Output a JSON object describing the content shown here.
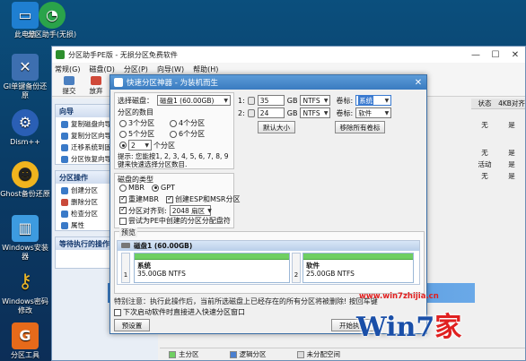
{
  "desktop": {
    "icons": [
      {
        "label": "此电脑",
        "color": "#1f7fd1"
      },
      {
        "label": "分区助手(无损)",
        "color": "#2aa34a"
      },
      {
        "label": "GI单键备份还原",
        "color": "#3d6fb0"
      },
      {
        "label": "Dism++",
        "color": "#2a5fb5"
      },
      {
        "label": "Ghost备份还原",
        "color": "#f0b41e"
      },
      {
        "label": "Windows安装器",
        "color": "#3d9be0"
      },
      {
        "label": "Windows密码修改",
        "color": "#e8b52a"
      },
      {
        "label": "分区工具",
        "color": "#e66a1a"
      }
    ]
  },
  "app": {
    "title": "分区助手PE版 - 无损分区免费软件",
    "window_buttons": [
      "—",
      "☐",
      "✕"
    ],
    "menus": [
      "常规(G)",
      "磁盘(D)",
      "分区(P)",
      "向导(W)",
      "帮助(H)"
    ],
    "toolbar": [
      {
        "label": "提交"
      },
      {
        "label": "放弃"
      }
    ],
    "left_sections": [
      {
        "title": "向导",
        "items": [
          "复制磁盘向导",
          "复制分区向导",
          "迁移系统到固态",
          "分区恢复向导"
        ]
      },
      {
        "title": "分区操作",
        "items": [
          "创建分区",
          "删除分区",
          "检查分区",
          "属性"
        ]
      },
      {
        "title": "等待执行的操作",
        "items": []
      }
    ],
    "columns": [
      "状态",
      "4KB对齐"
    ],
    "rows": [
      [
        "无",
        "是"
      ],
      [
        "无",
        "是"
      ],
      [
        "活动",
        "是"
      ],
      [
        "无",
        "是"
      ]
    ],
    "legend": [
      {
        "label": "主分区",
        "color": "#6fcf62"
      },
      {
        "label": "逻辑分区",
        "color": "#4a7fd0"
      },
      {
        "label": "未分配空间",
        "color": "#dcdcdc"
      }
    ]
  },
  "dialog": {
    "title": "快速分区神器 - 为装机而生",
    "close": "✕",
    "select_disk_label": "选择磁盘：",
    "select_disk_value": "磁盘1 (60.00GB)",
    "partition_count_label": "分区的数目",
    "count_options": [
      "3个分区",
      "4个分区",
      "5个分区",
      "6个分区"
    ],
    "custom_count_value": "2",
    "custom_count_suffix": "个分区",
    "hint": "提示: 您能按1, 2, 3, 4, 5, 6, 7, 8, 9键来快速选择分区数目.",
    "disk_type_label": "磁盘的类型",
    "disk_types": [
      "MBR",
      "GPT"
    ],
    "rebuild_mbr": "重建MBR",
    "create_esp": "创建ESP和MSR分区",
    "align_label": "分区对齐到:",
    "align_value": "2048 扇区",
    "pe_hint": "尝试为PE中创建的分区分配盘符",
    "partitions": [
      {
        "index": "1:",
        "size": "35",
        "unit": "GB",
        "fs": "NTFS",
        "label_text": "卷标:",
        "label_value": "系统"
      },
      {
        "index": "2:",
        "size": "24",
        "unit": "GB",
        "fs": "NTFS",
        "label_text": "卷标:",
        "label_value": "软件"
      }
    ],
    "default_size_btn": "默认大小",
    "remove_labels_btn": "移除所有卷标",
    "preview_label": "预览",
    "disk_name": "磁盘1 (60.00GB)",
    "parts_preview": [
      {
        "num": "1",
        "name": "系统",
        "detail": "35.00GB NTFS"
      },
      {
        "num": "2",
        "name": "软件",
        "detail": "25.00GB NTFS"
      }
    ],
    "notice": "特别注意：执行此操作后，当前所选磁盘上已经存在的所有分区将被删除! 按回车键",
    "reboot_check": "下次启动软件时直接进入快速分区窗口",
    "preset_btn": "预设置",
    "start_btn": "开始执行"
  },
  "watermark": {
    "url": "www.win7zhijia.cn",
    "logo_a": "Win7",
    "logo_b": "家"
  }
}
